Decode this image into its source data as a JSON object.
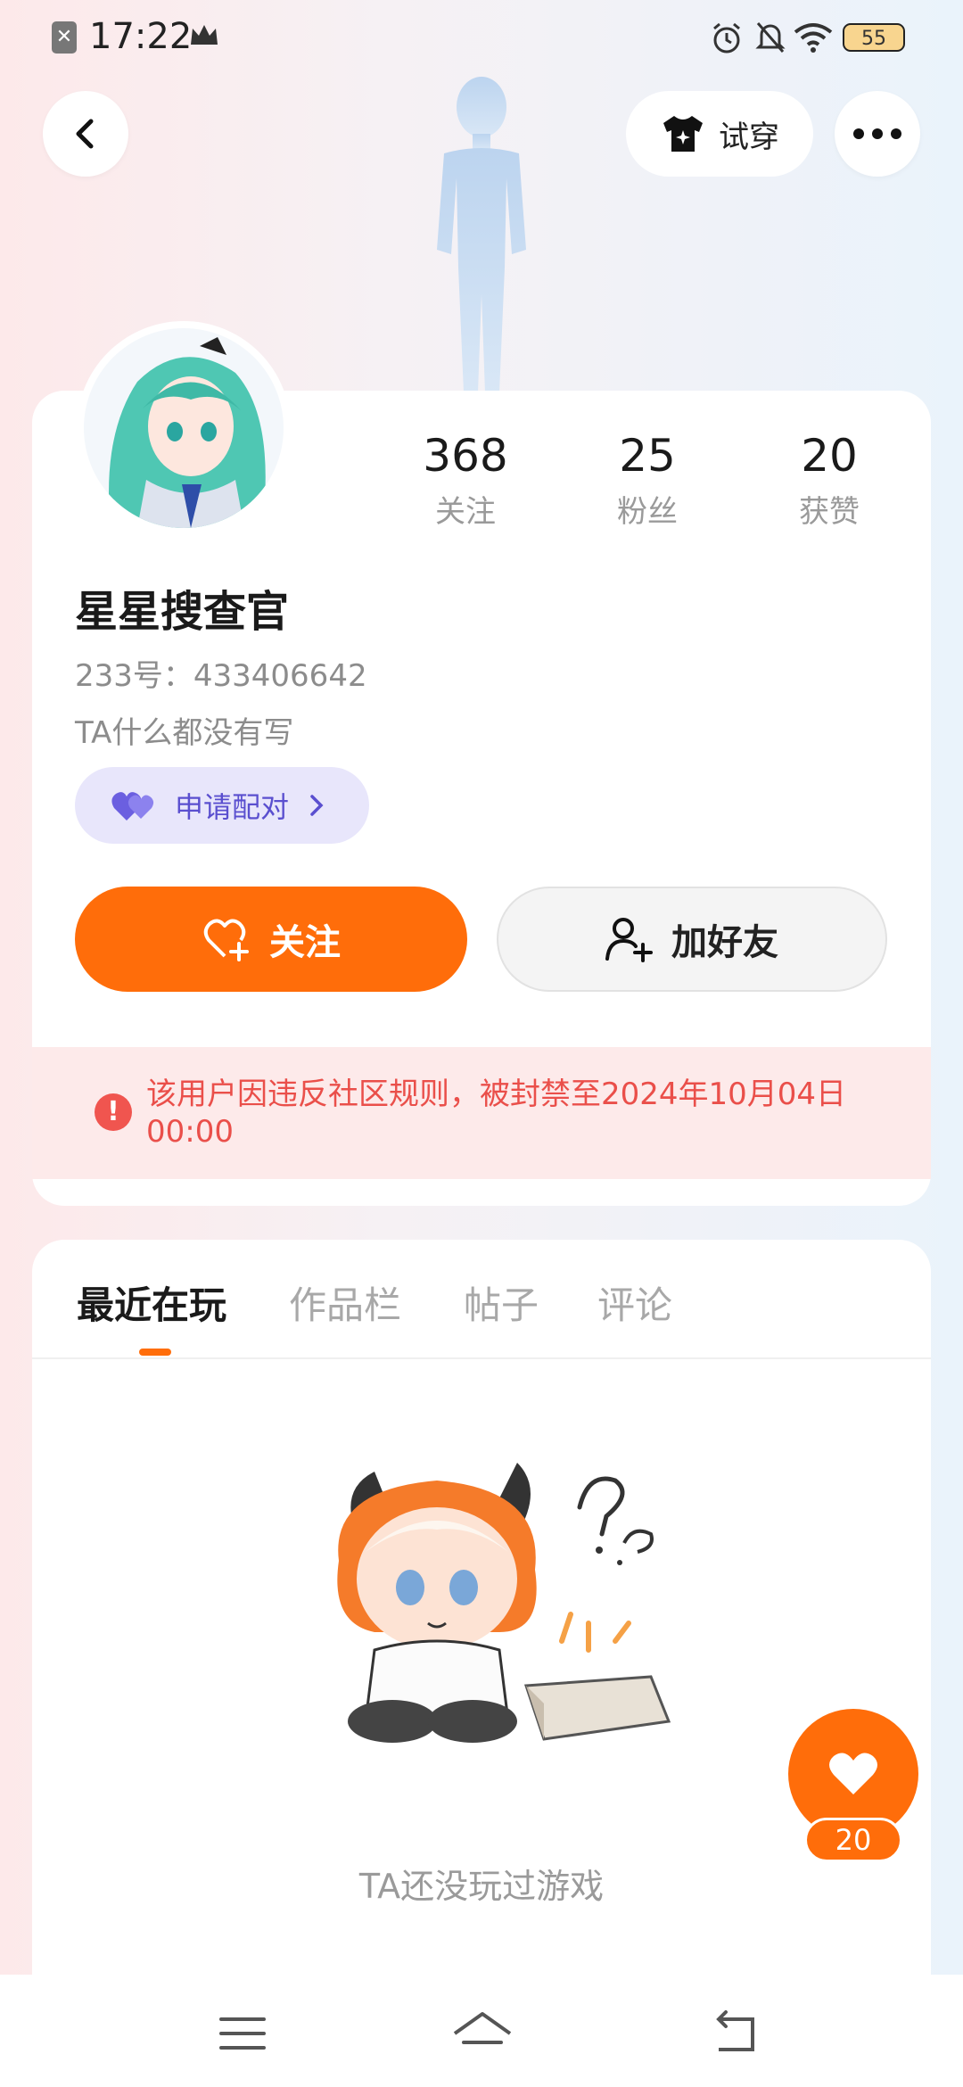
{
  "status_bar": {
    "time": "17:22",
    "battery": "55"
  },
  "header": {
    "tryon_label": "试穿"
  },
  "profile": {
    "stats": [
      {
        "value": "368",
        "label": "关注"
      },
      {
        "value": "25",
        "label": "粉丝"
      },
      {
        "value": "20",
        "label": "获赞"
      }
    ],
    "username": "星星搜查官",
    "uid": "233号：433406642",
    "bio": "TA什么都没有写",
    "pair_label": "申请配对",
    "follow_label": "关注",
    "add_friend_label": "加好友",
    "ban_notice": "该用户因违反社区规则，被封禁至2024年10月04日 00:00"
  },
  "tabs": [
    {
      "label": "最近在玩",
      "active": true
    },
    {
      "label": "作品栏",
      "active": false
    },
    {
      "label": "帖子",
      "active": false
    },
    {
      "label": "评论",
      "active": false
    }
  ],
  "empty_state": {
    "text": "TA还没玩过游戏"
  },
  "like_widget": {
    "count": "20"
  },
  "colors": {
    "accent": "#ff6d0a",
    "ban_text": "#ea4f4a",
    "pair_purple": "#5a4fcf"
  }
}
